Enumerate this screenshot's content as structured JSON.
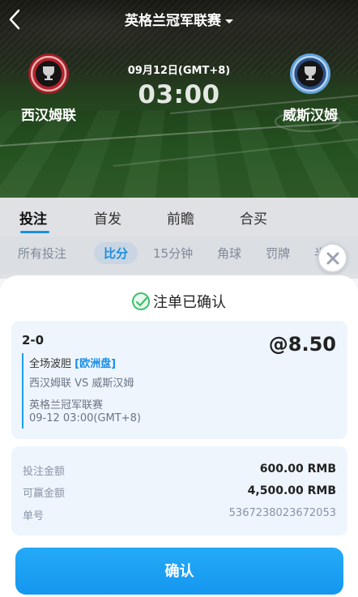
{
  "header": {
    "league_title": "英格兰冠军联赛"
  },
  "match": {
    "home_team": "西汉姆联",
    "away_team": "威斯汉姆",
    "date": "09月12日(GMT+8)",
    "time": "03:00"
  },
  "tabs": [
    {
      "label": "投注"
    },
    {
      "label": "首发"
    },
    {
      "label": "前瞻"
    },
    {
      "label": "合买"
    }
  ],
  "sub_tabs": [
    {
      "label": "所有投注"
    },
    {
      "label": "比分"
    },
    {
      "label": "15分钟"
    },
    {
      "label": "角球"
    },
    {
      "label": "罚牌"
    },
    {
      "label": "半"
    }
  ],
  "confirmation": {
    "title": "注单已确认",
    "bet": {
      "score": "2-0",
      "odds": "@8.50",
      "market": "全场波胆",
      "market_tag": "[欧洲盘]",
      "fixture": "西汉姆联 VS 威斯汉姆",
      "league": "英格兰冠军联赛",
      "kickoff": "09-12 03:00(GMT+8)"
    },
    "summary": {
      "stake_label": "投注金额",
      "stake_value": "600.00 RMB",
      "win_label": "可赢金额",
      "win_value": "4,500.00 RMB",
      "order_label": "单号",
      "order_value": "5367238023672053"
    },
    "confirm_button": "确认"
  },
  "icons": {
    "back": "chevron-left-icon",
    "dropdown": "caret-down-icon",
    "close": "close-icon",
    "check": "check-circle-icon"
  },
  "colors": {
    "accent": "#1aa0f0",
    "success": "#3cc06a"
  }
}
